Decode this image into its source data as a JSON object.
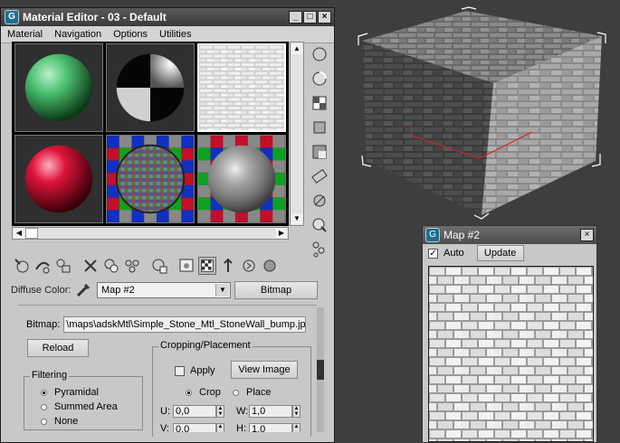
{
  "material_editor": {
    "title": "Material Editor - 03 - Default",
    "window_controls": [
      "_",
      "□",
      "×"
    ],
    "menu": [
      "Material",
      "Navigation",
      "Options",
      "Utilities"
    ],
    "slots": [
      {
        "name": "green-sphere",
        "color": "#3fb364"
      },
      {
        "name": "black-white-sphere",
        "color": "#888888"
      },
      {
        "name": "stone-texture",
        "color": "#d8d8d8"
      },
      {
        "name": "red-sphere",
        "color": "#d8143c"
      },
      {
        "name": "checker-sphere",
        "color": "#505050"
      },
      {
        "name": "glossy-checker-sphere",
        "color": "#a0a0a0"
      }
    ],
    "sidebar_icons": [
      "sample-type-icon",
      "backlight-icon",
      "background-icon",
      "sample-uv-icon",
      "video-color-check-icon",
      "make-preview-icon",
      "options-icon",
      "select-by-material-icon",
      "material-map-navigator-icon"
    ],
    "toolbar_icons": [
      "get-material-icon",
      "put-to-scene-icon",
      "assign-to-selection-icon",
      "reset-map-icon",
      "make-unique-icon",
      "put-to-library-icon",
      "material-id-channel-icon",
      "show-shaded-icon",
      "show-end-result-icon",
      "go-to-parent-icon",
      "go-forward-icon"
    ],
    "diffuse": {
      "label": "Diffuse Color:",
      "map_name": "Map #2",
      "type_button": "Bitmap"
    },
    "bitmap": {
      "label": "Bitmap:",
      "path": "\\maps\\adskMtl\\Simple_Stone_Mtl_StoneWall_bump.jpg",
      "reload_label": "Reload"
    },
    "filtering": {
      "title": "Filtering",
      "options": [
        "Pyramidal",
        "Summed Area",
        "None"
      ],
      "selected": 0
    },
    "cropping": {
      "title": "Cropping/Placement",
      "apply_label": "Apply",
      "view_image_label": "View Image",
      "crop_label": "Crop",
      "place_label": "Place",
      "u_label": "U:",
      "u_value": "0,0",
      "v_label": "V:",
      "v_value": "0,0",
      "w_label": "W:",
      "w_value": "1,0",
      "h_label": "H:",
      "h_value": "1,0"
    }
  },
  "map_window": {
    "title": "Map #2",
    "close": "×",
    "auto_label": "Auto",
    "auto_checked": true,
    "update_label": "Update"
  },
  "colors": {
    "viewport_bg": "#3e3e3e",
    "window_bg": "#c8c8c8",
    "title_bar": "#4a4a4a"
  }
}
